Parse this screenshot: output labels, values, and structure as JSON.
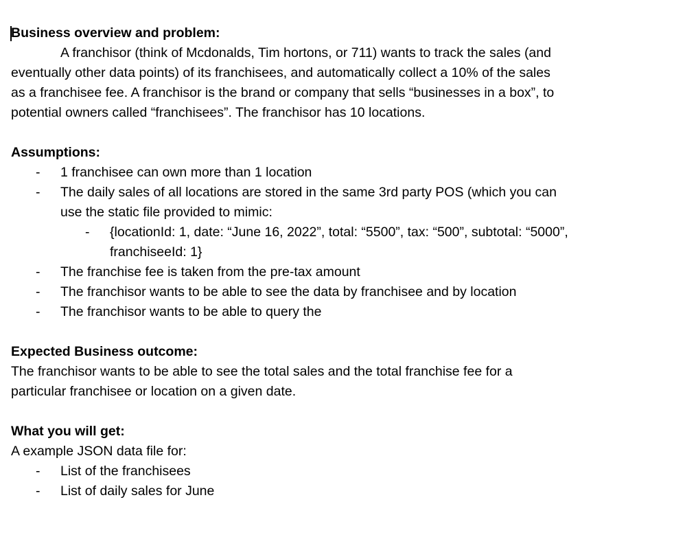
{
  "business": {
    "heading": "Business overview and problem:",
    "para_lines": [
      "A franchisor (think of Mcdonalds, Tim hortons, or 711) wants to track the sales (and",
      "eventually other data points) of its franchisees, and automatically collect a 10% of the sales",
      "as a franchisee fee. A franchisor is the brand or company that sells “businesses in a box”, to",
      "potential owners called “franchisees”. The franchisor has 10 locations."
    ]
  },
  "assumptions": {
    "heading": "Assumptions:",
    "bullet_marker": "-",
    "items": [
      "1 franchisee can own more than 1 location",
      "The daily sales of all locations are stored in the same 3rd party POS (which you can",
      "use the static file provided to mimic:",
      "{locationId: 1, date: “June 16, 2022”, total: “5500”, tax: “500”, subtotal: “5000”,",
      "franchiseeId: 1}",
      "The franchise fee is taken from the pre-tax amount",
      "The franchisor wants to be able to see the data by franchisee and by location",
      "The franchisor wants to be able to query the"
    ]
  },
  "outcome": {
    "heading": "Expected Business outcome:",
    "lines": [
      "The franchisor wants to be able to see the total sales and the total franchise fee for a",
      "particular franchisee or location on a given date."
    ]
  },
  "get": {
    "heading": "What you will get:",
    "intro": "A example JSON data file for:",
    "items": [
      "List of the franchisees",
      "List of daily sales for June"
    ]
  }
}
